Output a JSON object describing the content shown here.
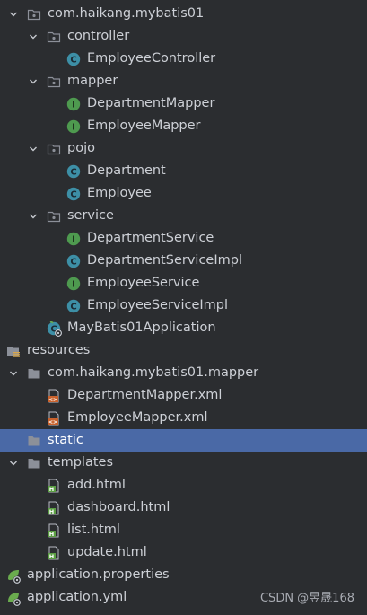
{
  "tree": [
    {
      "label": "com.haikang.mybatis01",
      "depth": 0,
      "icon": "package",
      "expanded": true
    },
    {
      "label": "controller",
      "depth": 1,
      "icon": "package",
      "expanded": true
    },
    {
      "label": "EmployeeController",
      "depth": 2,
      "icon": "class"
    },
    {
      "label": "mapper",
      "depth": 1,
      "icon": "package",
      "expanded": true
    },
    {
      "label": "DepartmentMapper",
      "depth": 2,
      "icon": "interface"
    },
    {
      "label": "EmployeeMapper",
      "depth": 2,
      "icon": "interface"
    },
    {
      "label": "pojo",
      "depth": 1,
      "icon": "package",
      "expanded": true
    },
    {
      "label": "Department",
      "depth": 2,
      "icon": "class"
    },
    {
      "label": "Employee",
      "depth": 2,
      "icon": "class"
    },
    {
      "label": "service",
      "depth": 1,
      "icon": "package",
      "expanded": true
    },
    {
      "label": "DepartmentService",
      "depth": 2,
      "icon": "interface"
    },
    {
      "label": "DepartmentServiceImpl",
      "depth": 2,
      "icon": "class"
    },
    {
      "label": "EmployeeService",
      "depth": 2,
      "icon": "interface"
    },
    {
      "label": "EmployeeServiceImpl",
      "depth": 2,
      "icon": "class"
    },
    {
      "label": "MayBatis01Application",
      "depth": 1,
      "icon": "spring-boot-class"
    },
    {
      "label": "resources",
      "depth": -1,
      "icon": "resources-folder"
    },
    {
      "label": "com.haikang.mybatis01.mapper",
      "depth": 0,
      "icon": "folder",
      "expanded": true
    },
    {
      "label": "DepartmentMapper.xml",
      "depth": 1,
      "icon": "xml-file"
    },
    {
      "label": "EmployeeMapper.xml",
      "depth": 1,
      "icon": "xml-file"
    },
    {
      "label": "static",
      "depth": 0,
      "icon": "folder",
      "selected": true
    },
    {
      "label": "templates",
      "depth": 0,
      "icon": "folder",
      "expanded": true
    },
    {
      "label": "add.html",
      "depth": 1,
      "icon": "html-file"
    },
    {
      "label": "dashboard.html",
      "depth": 1,
      "icon": "html-file"
    },
    {
      "label": "list.html",
      "depth": 1,
      "icon": "html-file"
    },
    {
      "label": "update.html",
      "depth": 1,
      "icon": "html-file"
    },
    {
      "label": "application.properties",
      "depth": -1,
      "icon": "spring-config-file"
    },
    {
      "label": "application.yml",
      "depth": -1,
      "icon": "spring-config-file"
    }
  ],
  "watermark": "CSDN @昱晟168",
  "colors": {
    "background": "#2b2d30",
    "selection": "#4a69a6",
    "class_icon": "#3d8fa6",
    "interface_icon": "#4e9a4f",
    "xml_icon": "#c9622d",
    "html_icon": "#5b9e43",
    "folder_icon": "#8c9099",
    "spring": "#6aab4e"
  }
}
